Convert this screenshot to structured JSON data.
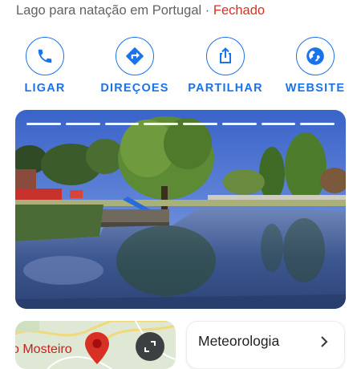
{
  "place": {
    "category": "Lago para natação em Portugal",
    "separator": "·",
    "status": "Fechado"
  },
  "actions": [
    {
      "label": "LIGAR",
      "icon": "phone-icon"
    },
    {
      "label": "DIREÇOES",
      "icon": "directions-icon"
    },
    {
      "label": "PARTILHAR",
      "icon": "share-icon"
    },
    {
      "label": "WEBSITE",
      "icon": "globe-icon"
    }
  ],
  "photo": {
    "slides": 8,
    "description_icon": "lake-photo"
  },
  "map": {
    "label": "o Mosteiro",
    "expand_icon": "expand-icon"
  },
  "weather": {
    "title": "Meteorologia",
    "icon": "chevron-right-icon"
  },
  "colors": {
    "accent": "#1a73e8",
    "closed": "#d93025",
    "text_secondary": "#5f6368"
  }
}
